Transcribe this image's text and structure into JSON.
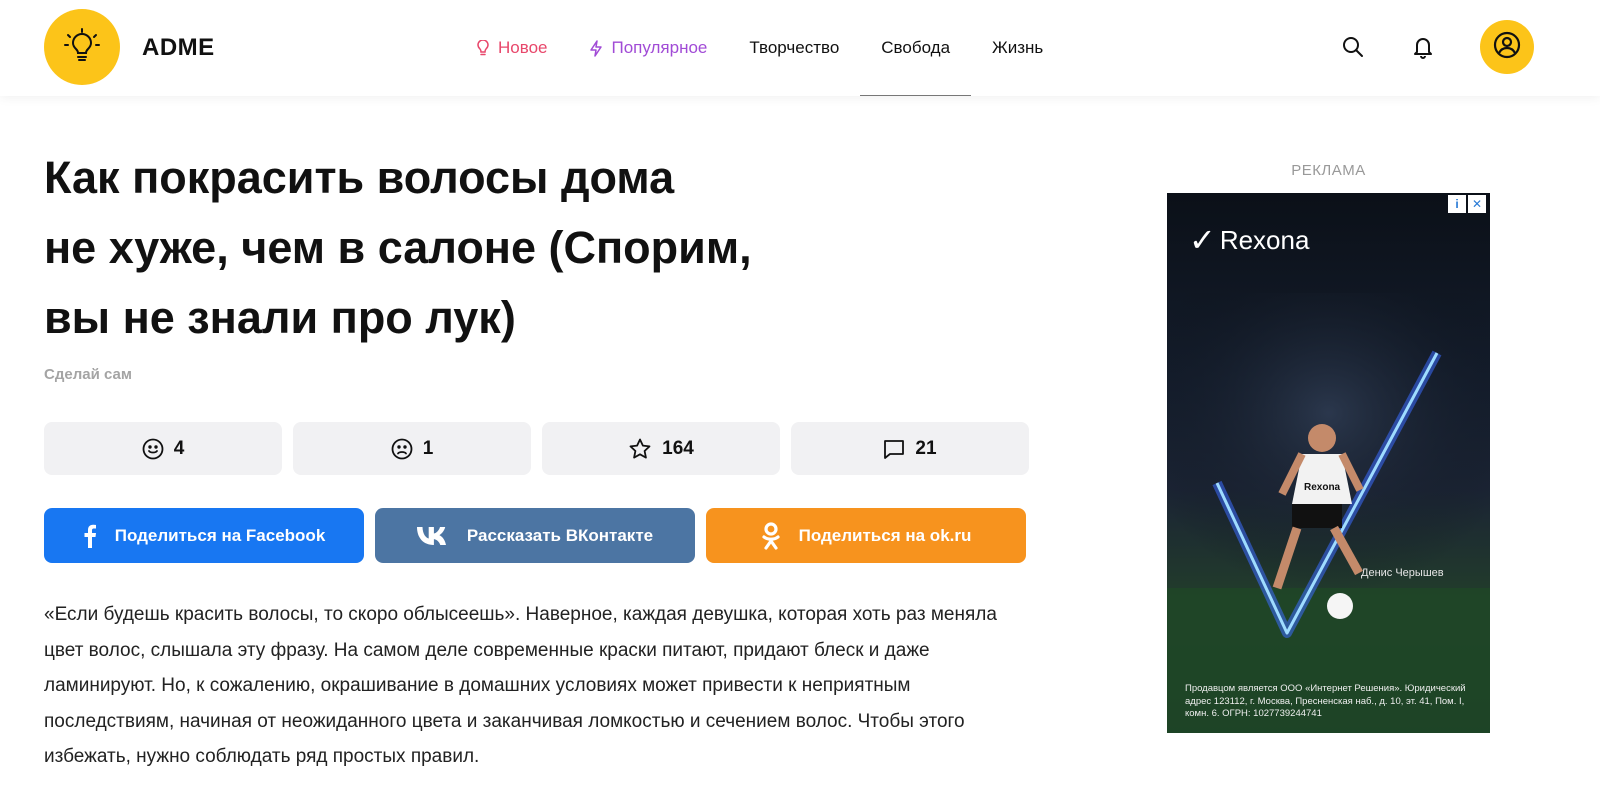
{
  "header": {
    "logo_text": "ADME",
    "nav": [
      {
        "label": "Новое",
        "icon": "bulb-icon",
        "color": "#e8476b"
      },
      {
        "label": "Популярное",
        "icon": "lightning-icon",
        "color": "#a14bd6"
      },
      {
        "label": "Творчество"
      },
      {
        "label": "Свобода",
        "active": true
      },
      {
        "label": "Жизнь"
      }
    ],
    "accent_color": "#fcc419"
  },
  "article": {
    "title_lines": [
      "Как покрасить волосы дома",
      "не хуже, чем в салоне (Спорим,",
      "вы не знали про лук)"
    ],
    "category": "Сделай сам",
    "reactions": [
      {
        "icon": "smile-icon",
        "count": "4"
      },
      {
        "icon": "sad-icon",
        "count": "1"
      },
      {
        "icon": "star-icon",
        "count": "164"
      },
      {
        "icon": "comment-icon",
        "count": "21"
      }
    ],
    "shares": [
      {
        "label": "Поделиться на Facebook",
        "icon": "facebook-icon",
        "color": "#1877f2"
      },
      {
        "label": "Рассказать ВКонтакте",
        "icon": "vk-icon",
        "color": "#4c75a3"
      },
      {
        "label": "Поделиться на ok.ru",
        "icon": "ok-icon",
        "color": "#f7931e"
      }
    ],
    "body": "«Если будешь красить волосы, то скоро облысеешь». Наверное, каждая девушка, которая хоть раз меняла цвет волос, слышала эту фразу. На самом деле современные краски питают, придают блеск и даже ламинируют. Но, к сожалению, окрашивание в домашних условиях может привести к неприятным последствиям, начиная от неожиданного цвета и заканчивая ломкостью и сечением волос. Чтобы этого избежать, нужно соблюдать ряд простых правил."
  },
  "ad": {
    "label": "РЕКЛАМА",
    "brand": "Rexona",
    "shirt_text": "Rexona",
    "player_name": "Денис Черышев",
    "legal": "Продавцом является ООО «Интернет Решения». Юридический адрес 123112, г. Москва, Пресненская наб., д. 10, эт. 41, Пом. I, комн. 6. ОГРН: 1027739244741"
  }
}
